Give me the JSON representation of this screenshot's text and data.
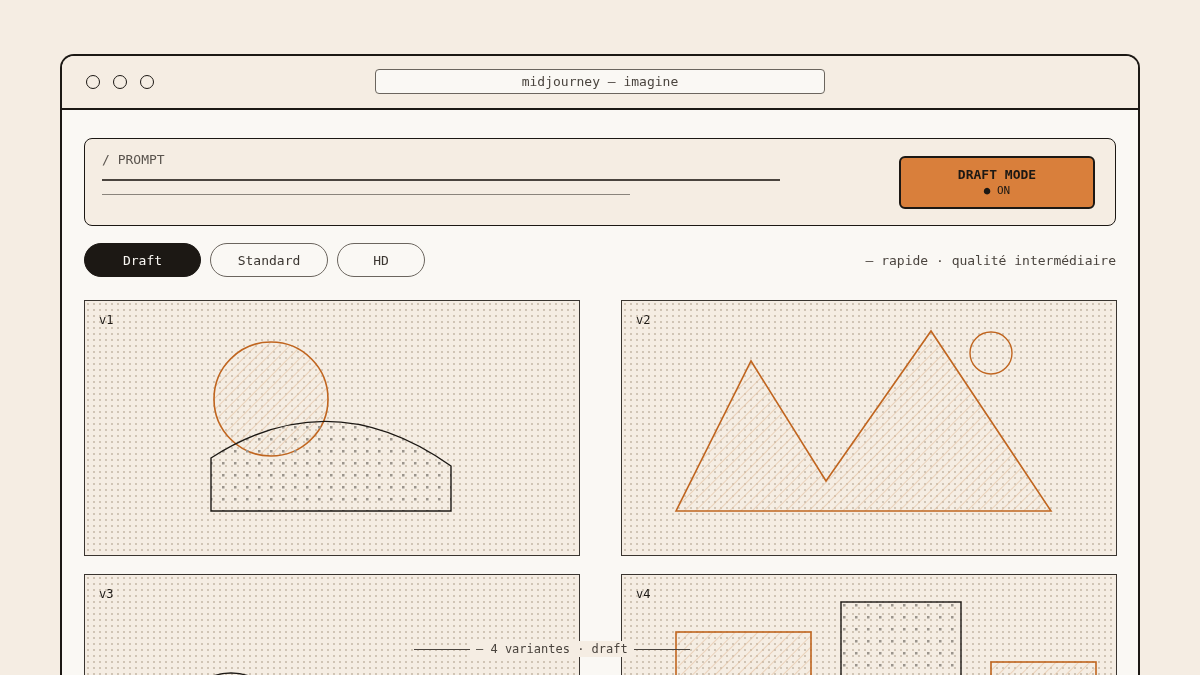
{
  "window": {
    "title": "midjourney — imagine"
  },
  "prompt": {
    "label": "/ PROMPT"
  },
  "draft_mode": {
    "label": "DRAFT MODE",
    "state": "● ON",
    "on": true
  },
  "tabs": [
    {
      "label": "Draft",
      "selected": true
    },
    {
      "label": "Standard",
      "selected": false
    },
    {
      "label": "HD",
      "selected": false
    }
  ],
  "tab_hint": "— rapide · qualité intermédiaire",
  "variants": [
    {
      "label": "v1",
      "kind": "sun-hill"
    },
    {
      "label": "v2",
      "kind": "peaks"
    },
    {
      "label": "v3",
      "kind": "arc"
    },
    {
      "label": "v4",
      "kind": "blocks"
    }
  ],
  "caption": "— 4 variantes · draft"
}
